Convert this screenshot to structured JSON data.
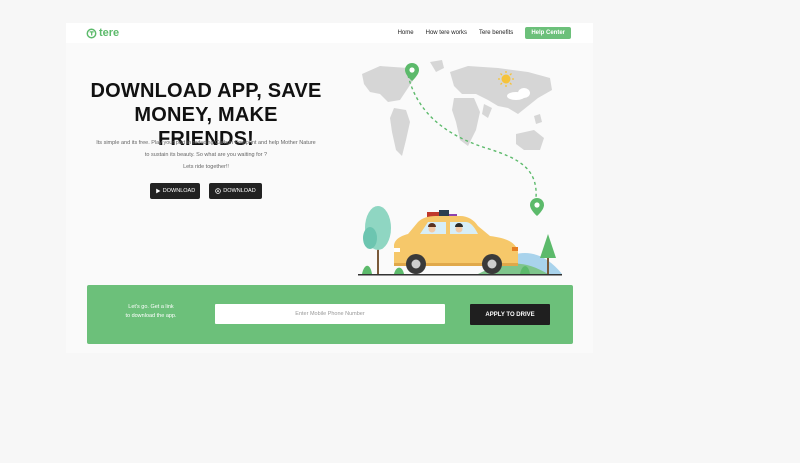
{
  "brand": {
    "name": "tere",
    "color": "#5cba6b"
  },
  "nav": {
    "links": [
      "Home",
      "How tere works",
      "Tere benefits"
    ],
    "help_label": "Help Center"
  },
  "hero": {
    "title_line1": "DOWNLOAD APP, SAVE",
    "title_line2": "MONEY, MAKE FRIENDS!",
    "desc_line1": "Its simple and its free. Play your part in reducing Carbon Footprint and help Mother Nature",
    "desc_line2": "to sustain its beauty. So what are you waiting for ?",
    "desc_line3": "Lets ride together!!"
  },
  "downloads": [
    {
      "label": "DOWNLOAD",
      "icon": "play-store-icon"
    },
    {
      "label": "DOWNLOAD",
      "icon": "apple-icon"
    }
  ],
  "cta": {
    "text_line1": "Let's go. Get a link",
    "text_line2": "to download the app.",
    "phone_placeholder": "Enter Mobile Phone Number",
    "apply_label": "APPLY TO DRIVE",
    "bg_color": "#6cc07a"
  }
}
